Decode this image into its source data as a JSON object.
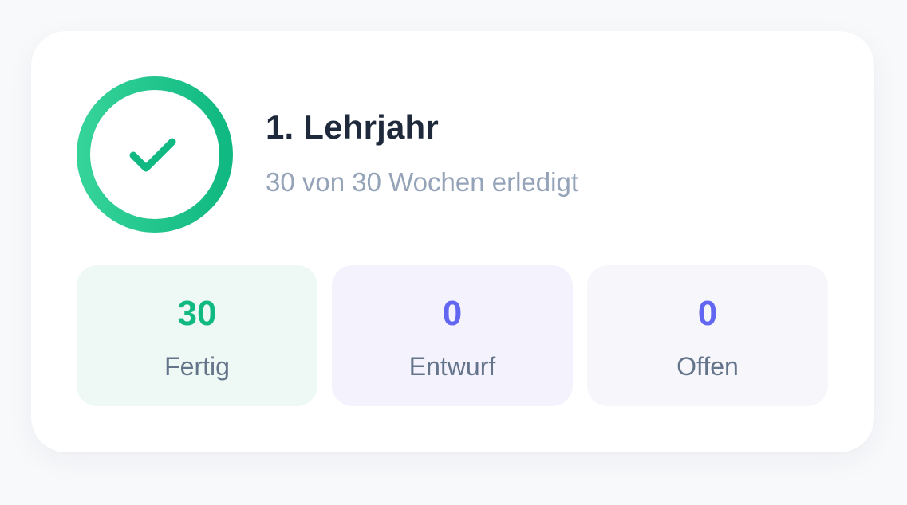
{
  "year_card": {
    "title": "1. Lehrjahr",
    "subtitle": "30 von 30 Wochen erledigt",
    "progress": {
      "completed_weeks": 30,
      "total_weeks": 30,
      "fraction": 1.0
    },
    "status_icon": "checkmark-icon"
  },
  "stats": [
    {
      "value": "30",
      "label": "Fertig",
      "color": "#10b981"
    },
    {
      "value": "0",
      "label": "Entwurf",
      "color": "#6366f1"
    },
    {
      "value": "0",
      "label": "Offen",
      "color": "#6366f1"
    }
  ],
  "colors": {
    "accent_green": "#10b981",
    "accent_indigo": "#6366f1",
    "title": "#1e293b",
    "subtitle": "#94a3b8"
  }
}
